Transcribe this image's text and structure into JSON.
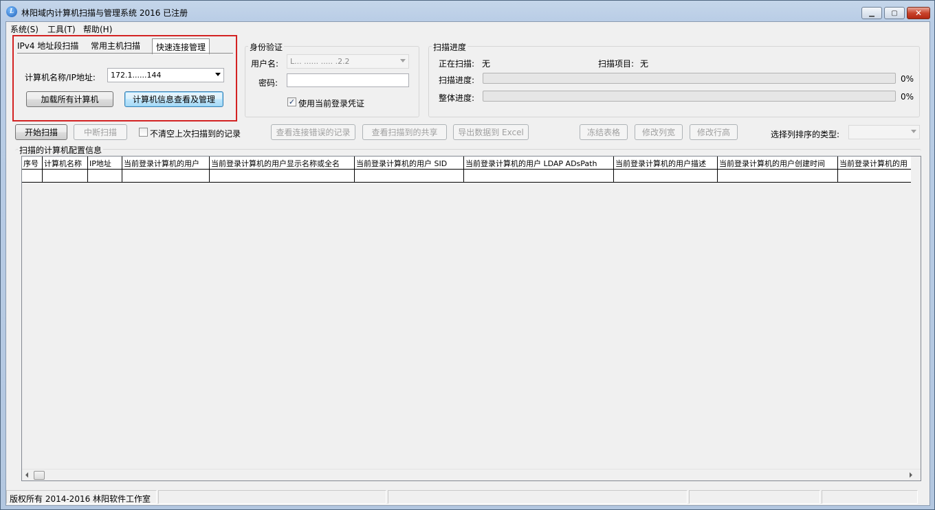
{
  "window": {
    "title": "林阳域内计算机扫描与管理系统 2016 已注册"
  },
  "menu": [
    "系统(S)",
    "工具(T)",
    "帮助(H)"
  ],
  "tabs": [
    "IPv4 地址段扫描",
    "常用主机扫描",
    "快速连接管理"
  ],
  "quick_connect": {
    "host_label": "计算机名称/IP地址:",
    "host_value": "172.1......144",
    "load_all_button": "加载所有计算机",
    "info_manage_button": "计算机信息查看及管理"
  },
  "auth": {
    "title": "身份验证",
    "username_label": "用户名:",
    "username_value": "L... ...... ..... .2.2",
    "password_label": "密码:",
    "use_current_label": "使用当前登录凭证",
    "use_current_checked": true
  },
  "progress": {
    "title": "扫描进度",
    "scanning_label": "正在扫描:",
    "scanning_value": "无",
    "item_label": "扫描项目:",
    "item_value": "无",
    "scan_label": "扫描进度:",
    "scan_percent": "0%",
    "scan_fraction": 0,
    "overall_label": "整体进度:",
    "overall_percent": "0%",
    "overall_fraction": 0
  },
  "toolbar": {
    "start": "开始扫描",
    "stop": "中断扫描",
    "keep_label": "不清空上次扫描到的记录",
    "view_errors": "查看连接错误的记录",
    "view_shares": "查看扫描到的共享",
    "export": "导出数据到 Excel",
    "freeze": "冻结表格",
    "col_width": "修改列宽",
    "row_height": "修改行高",
    "sort_label": "选择列排序的类型:"
  },
  "grid": {
    "title": "扫描的计算机配置信息",
    "columns": [
      "序号",
      "计算机名称",
      "IP地址",
      "当前登录计算机的用户",
      "当前登录计算机的用户显示名称或全名",
      "当前登录计算机的用户 SID",
      "当前登录计算机的用户 LDAP ADsPath",
      "当前登录计算机的用户描述",
      "当前登录计算机的用户创建时间",
      "当前登录计算机的用"
    ]
  },
  "status": {
    "copyright": "版权所有 2014-2016 林阳软件工作室"
  }
}
